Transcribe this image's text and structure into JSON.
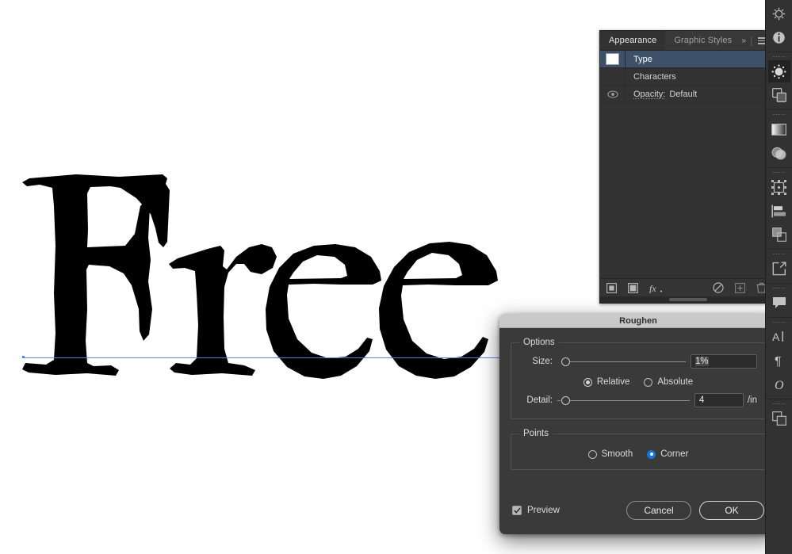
{
  "canvas": {
    "artwork_text": "Free",
    "baseline_color": "#5d7fe0",
    "background": "#ffffff"
  },
  "appearance_panel": {
    "tabs": [
      {
        "label": "Appearance",
        "active": true
      },
      {
        "label": "Graphic Styles",
        "active": false
      }
    ],
    "collapse_icon": "»",
    "menu_icon": "panel-menu-icon",
    "rows": [
      {
        "name": "type",
        "label": "Type",
        "selected": true,
        "has_swatch": true,
        "has_eye": false
      },
      {
        "name": "characters",
        "label": "Characters",
        "selected": false,
        "has_swatch": false,
        "has_eye": false
      },
      {
        "name": "opacity",
        "label": "Opacity:",
        "value": "Default",
        "selected": false,
        "has_swatch": false,
        "has_eye": true
      }
    ],
    "footer_icons": [
      "add-new-stroke-icon",
      "add-new-fill-icon",
      "add-new-effect-icon",
      "clear-appearance-icon",
      "duplicate-selected-item-icon",
      "delete-selected-item-icon"
    ]
  },
  "dialog": {
    "title": "Roughen",
    "options_group_label": "Options",
    "size": {
      "label": "Size:",
      "value": "1%",
      "slider_percent": 0
    },
    "size_mode": {
      "options": [
        {
          "label": "Relative",
          "selected": true
        },
        {
          "label": "Absolute",
          "selected": false
        }
      ]
    },
    "detail": {
      "label": "Detail:",
      "value": "4",
      "unit": "/in",
      "slider_percent": 2
    },
    "points_group_label": "Points",
    "points": {
      "options": [
        {
          "label": "Smooth",
          "selected": false
        },
        {
          "label": "Corner",
          "selected": true
        }
      ],
      "accent_color": "#1473e6"
    },
    "preview": {
      "label": "Preview",
      "checked": true
    },
    "buttons": [
      {
        "name": "cancel",
        "label": "Cancel",
        "primary": false
      },
      {
        "name": "ok",
        "label": "OK",
        "primary": true
      }
    ]
  },
  "toolbar_rail": {
    "groups": [
      {
        "grip": false,
        "items": [
          {
            "icon": "flow-settings-icon",
            "active": false
          },
          {
            "icon": "info-icon",
            "active": false
          }
        ]
      },
      {
        "grip": true,
        "items": [
          {
            "icon": "color-guide-icon",
            "active": true
          },
          {
            "icon": "swatches-icon",
            "active": false
          }
        ]
      },
      {
        "grip": true,
        "items": [
          {
            "icon": "gradient-icon",
            "active": false
          },
          {
            "icon": "transparency-icon",
            "active": false
          }
        ]
      },
      {
        "grip": true,
        "items": [
          {
            "icon": "transform-icon",
            "active": false
          },
          {
            "icon": "align-icon",
            "active": false
          },
          {
            "icon": "pathfinder-icon",
            "active": false
          }
        ]
      },
      {
        "grip": true,
        "items": [
          {
            "icon": "export-asset-icon",
            "active": false
          }
        ]
      },
      {
        "grip": true,
        "items": [
          {
            "icon": "comments-icon",
            "active": false
          }
        ]
      },
      {
        "grip": true,
        "items": [
          {
            "icon": "character-icon",
            "active": false
          },
          {
            "icon": "paragraph-icon",
            "active": false
          },
          {
            "icon": "glyphs-icon",
            "active": false
          }
        ]
      },
      {
        "grip": true,
        "items": [
          {
            "icon": "layers-icon",
            "active": false
          }
        ]
      }
    ]
  }
}
